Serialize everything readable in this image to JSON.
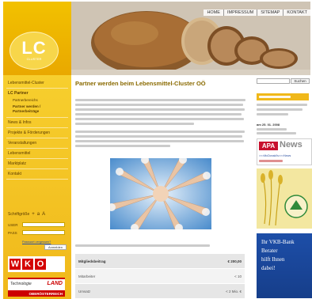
{
  "topnav": {
    "items": [
      "HOME",
      "IMPRESSUM",
      "SITEMAP",
      "KONTAKT"
    ]
  },
  "logo": {
    "text": "LC",
    "subtitle": "CLUSTER"
  },
  "sidebar": {
    "items": [
      {
        "label": "Lebensmittel-Cluster"
      },
      {
        "label": "LC Partner"
      },
      {
        "label": "Partnerbereichs"
      },
      {
        "label": "Partner werden / Partnerbeiträge"
      },
      {
        "label": "News & Infos"
      },
      {
        "label": "Projekte & Förderungen"
      },
      {
        "label": "Veranstaltungen"
      },
      {
        "label": "Lebensmittel"
      },
      {
        "label": "Marktplatz"
      },
      {
        "label": "Kontakt"
      }
    ],
    "font_size_label": "Schriftgröße",
    "font_size_buttons": [
      "+",
      "a",
      "A"
    ],
    "login": {
      "user_label": "USER",
      "pass_label": "PASS",
      "forgot_label": "Passwort vergessen?",
      "login_button": "Anmelden"
    },
    "logos": {
      "wko_letters": [
        "W",
        "K",
        "O"
      ],
      "ooe_tech": "Technologie",
      "ooe_land": "LAND",
      "ooe_region": "OBERÖSTERREICH"
    }
  },
  "main": {
    "title": "Partner werden beim Lebensmittel-Cluster OÖ",
    "table": [
      {
        "label": "Mitgliedsbeitrag",
        "value": "€ 200,00"
      },
      {
        "label": "Mitarbeiter",
        "value": "< 10"
      },
      {
        "label": "Umsatz",
        "value": "< 2 Mio. €"
      }
    ]
  },
  "right": {
    "search_button": "Suchen",
    "event_date": "am 25. 01. 2008",
    "apa": {
      "badge": "APA",
      "word": "News",
      "link": ">>>McDonald's>>>News"
    },
    "vkb": {
      "lines": [
        "Ihr VKB-Bank",
        "Berater",
        "hilft Ihnen",
        "dabei!"
      ]
    }
  },
  "colors": {
    "accent_yellow": "#f0b81a",
    "title_brown": "#8a6a00",
    "vkb_blue": "#1d4ea8",
    "wko_red": "#d40000",
    "apa_red": "#c8102e"
  }
}
